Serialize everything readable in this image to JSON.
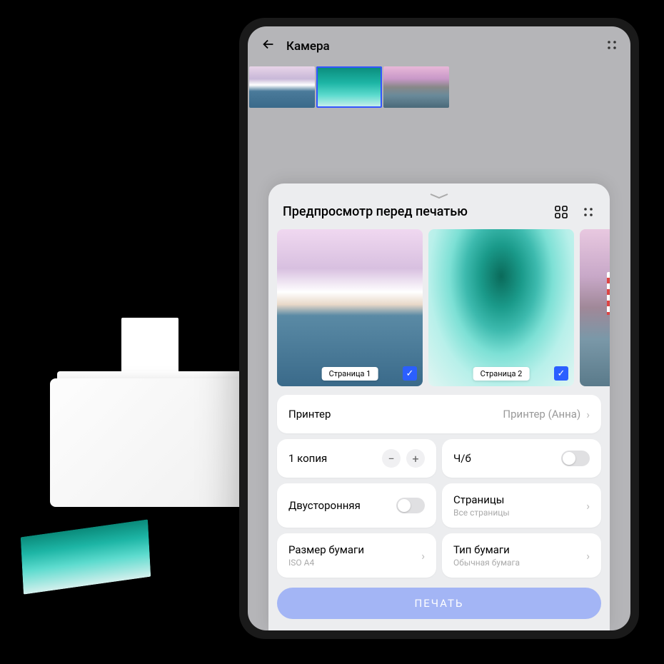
{
  "topbar": {
    "title": "Камера"
  },
  "sheet": {
    "title": "Предпросмотр перед печатью"
  },
  "previews": [
    {
      "label": "Страница 1",
      "checked": true
    },
    {
      "label": "Страница 2",
      "checked": true
    }
  ],
  "settings": {
    "printer_label": "Принтер",
    "printer_value": "Принтер (Анна)",
    "copies_label": "1 копия",
    "bw_label": "Ч/б",
    "duplex_label": "Двусторонняя",
    "pages_label": "Страницы",
    "pages_value": "Все страницы",
    "paper_size_label": "Размер бумаги",
    "paper_size_value": "ISO A4",
    "paper_type_label": "Тип бумаги",
    "paper_type_value": "Обычная бумага"
  },
  "print_button": "ПЕЧАТЬ"
}
